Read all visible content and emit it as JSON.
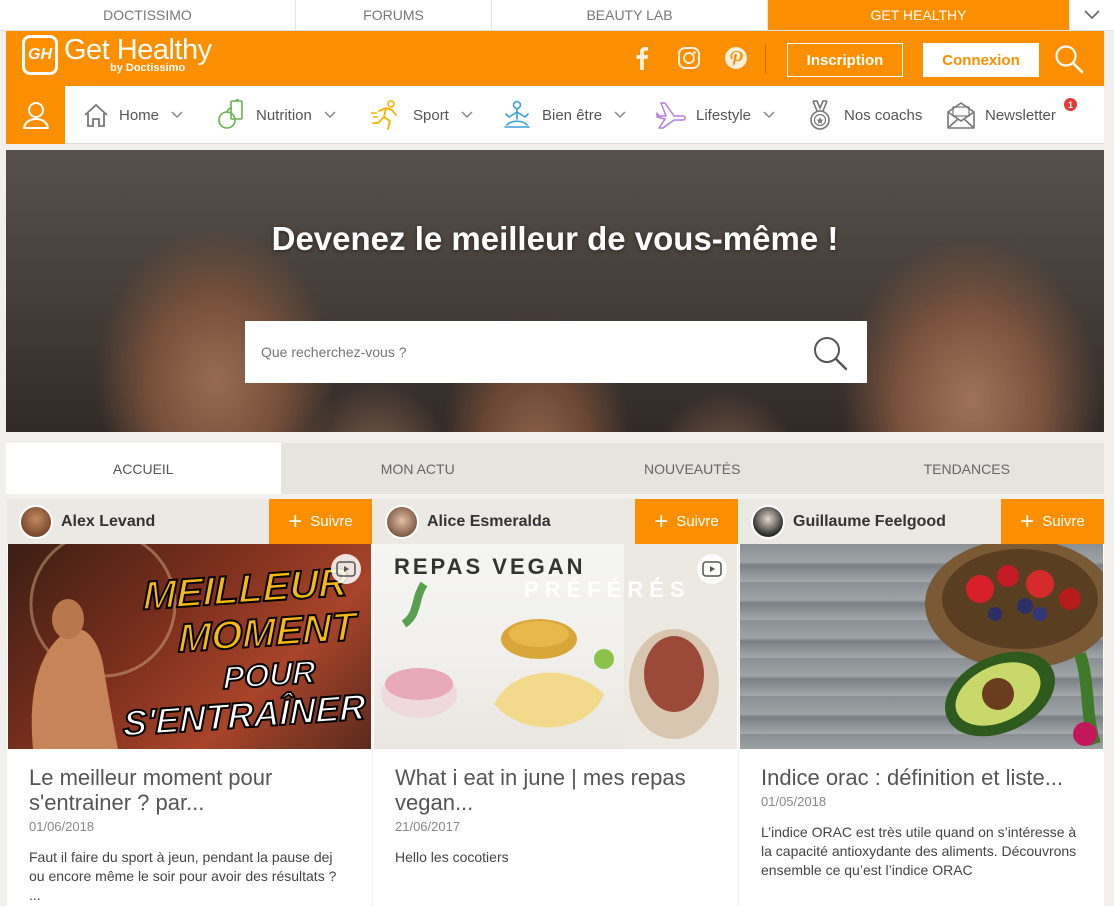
{
  "topbar": {
    "tabs": [
      {
        "label": "DOCTISSIMO"
      },
      {
        "label": "FORUMS"
      },
      {
        "label": "BEAUTY LAB"
      },
      {
        "label": "GET HEALTHY"
      }
    ]
  },
  "header": {
    "logo_badge": "GH",
    "logo_title": "Get Healthy",
    "logo_subtitle": "by Doctissimo",
    "inscription_label": "Inscription",
    "connexion_label": "Connexion",
    "accent_color": "#fb8f00"
  },
  "nav": {
    "items": [
      {
        "label": "Home",
        "icon": "home-icon"
      },
      {
        "label": "Nutrition",
        "icon": "nutrition-icon"
      },
      {
        "label": "Sport",
        "icon": "running-icon"
      },
      {
        "label": "Bien être",
        "icon": "meditation-icon"
      },
      {
        "label": "Lifestyle",
        "icon": "airplane-icon"
      },
      {
        "label": "Nos coachs",
        "icon": "medal-icon"
      },
      {
        "label": "Newsletter",
        "icon": "envelope-icon",
        "badge": "1"
      }
    ]
  },
  "hero": {
    "title": "Devenez le meilleur de vous-même !",
    "search_placeholder": "Que recherchez-vous ?"
  },
  "tabs": [
    {
      "label": "ACCUEIL",
      "active": true
    },
    {
      "label": "MON ACTU"
    },
    {
      "label": "NOUVEAUTÉS"
    },
    {
      "label": "TENDANCES"
    }
  ],
  "cards": [
    {
      "author": "Alex Levand",
      "follow_label": "Suivre",
      "image_text_1": "MEILLEUR",
      "image_text_2": "MOMENT",
      "image_text_3": "POUR",
      "image_text_4": "S'ENTRAÎNER",
      "title": "Le meilleur moment pour s'entrainer ? par...",
      "date": "01/06/2018",
      "text": "Faut il faire du sport à jeun, pendant la pause dej ou encore même le soir pour avoir des résultats ? ..."
    },
    {
      "author": "Alice Esmeralda",
      "follow_label": "Suivre",
      "image_text_1": "REPAS VEGAN",
      "image_text_2": "PRÉFÉRÉS",
      "title": "What i eat in june | mes repas vegan...",
      "date": "21/06/2017",
      "text": "Hello les cocotiers"
    },
    {
      "author": "Guillaume Feelgood",
      "follow_label": "Suivre",
      "title": "Indice orac : définition et liste...",
      "date": "01/05/2018",
      "text": "L’indice ORAC est très utile quand on s’intéresse à la capacité antioxydante des aliments. Découvrons ensemble ce qu’est l’indice ORAC"
    }
  ]
}
